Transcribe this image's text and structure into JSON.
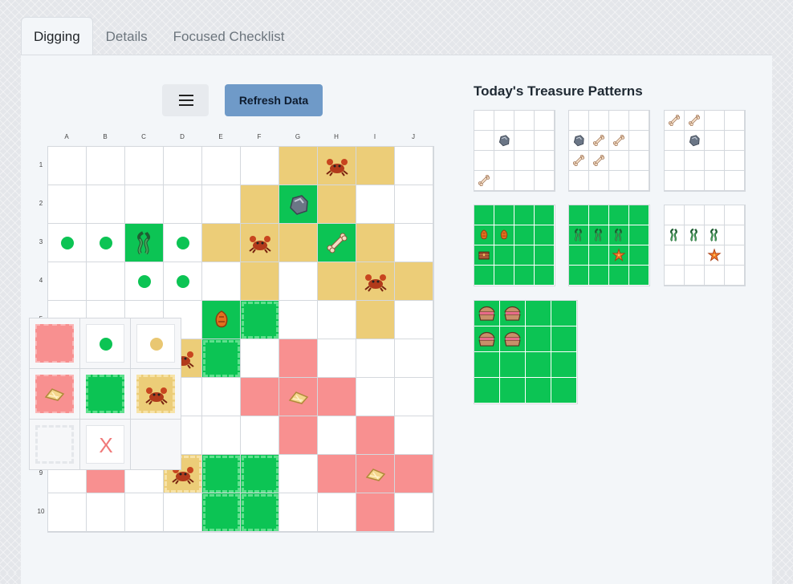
{
  "tabs": [
    {
      "label": "Digging",
      "active": true
    },
    {
      "label": "Details",
      "active": false
    },
    {
      "label": "Focused Checklist",
      "active": false
    }
  ],
  "toolbar": {
    "menu_icon": "hamburger-menu-icon",
    "refresh_label": "Refresh Data"
  },
  "board": {
    "columns": [
      "A",
      "B",
      "C",
      "D",
      "E",
      "F",
      "G",
      "H",
      "I",
      "J"
    ],
    "rows": [
      "1",
      "2",
      "3",
      "4",
      "5",
      "6",
      "7",
      "8",
      "9",
      "10"
    ],
    "cells": [
      {
        "r": 0,
        "c": 6,
        "s": "y"
      },
      {
        "r": 0,
        "c": 7,
        "s": "y",
        "item": "crab"
      },
      {
        "r": 0,
        "c": 8,
        "s": "y"
      },
      {
        "r": 1,
        "c": 5,
        "s": "y"
      },
      {
        "r": 1,
        "c": 6,
        "s": "g",
        "item": "stone"
      },
      {
        "r": 1,
        "c": 7,
        "s": "y"
      },
      {
        "r": 2,
        "c": 0,
        "s": "dot"
      },
      {
        "r": 2,
        "c": 1,
        "s": "dot"
      },
      {
        "r": 2,
        "c": 2,
        "s": "g",
        "item": "seaweed"
      },
      {
        "r": 2,
        "c": 3,
        "s": "dot"
      },
      {
        "r": 2,
        "c": 4,
        "s": "y"
      },
      {
        "r": 2,
        "c": 5,
        "s": "y",
        "item": "crab"
      },
      {
        "r": 2,
        "c": 6,
        "s": "y"
      },
      {
        "r": 2,
        "c": 7,
        "s": "g",
        "item": "bone"
      },
      {
        "r": 2,
        "c": 8,
        "s": "y"
      },
      {
        "r": 3,
        "c": 2,
        "s": "dot"
      },
      {
        "r": 3,
        "c": 3,
        "s": "dot"
      },
      {
        "r": 3,
        "c": 5,
        "s": "y"
      },
      {
        "r": 3,
        "c": 7,
        "s": "y"
      },
      {
        "r": 3,
        "c": 8,
        "s": "y",
        "item": "crab"
      },
      {
        "r": 3,
        "c": 9,
        "s": "y"
      },
      {
        "r": 4,
        "c": 4,
        "s": "g",
        "item": "amber"
      },
      {
        "r": 4,
        "c": 5,
        "s": "gd"
      },
      {
        "r": 4,
        "c": 8,
        "s": "y"
      },
      {
        "r": 5,
        "c": 3,
        "s": "y",
        "item": "crab"
      },
      {
        "r": 5,
        "c": 4,
        "s": "gd"
      },
      {
        "r": 5,
        "c": 6,
        "s": "r"
      },
      {
        "r": 6,
        "c": 5,
        "s": "r"
      },
      {
        "r": 6,
        "c": 6,
        "s": "r",
        "item": "shell"
      },
      {
        "r": 6,
        "c": 7,
        "s": "r"
      },
      {
        "r": 7,
        "c": 6,
        "s": "r"
      },
      {
        "r": 7,
        "c": 8,
        "s": "r"
      },
      {
        "r": 8,
        "c": 1,
        "s": "r"
      },
      {
        "r": 8,
        "c": 3,
        "s": "yd",
        "item": "crab"
      },
      {
        "r": 8,
        "c": 4,
        "s": "gd"
      },
      {
        "r": 8,
        "c": 5,
        "s": "gd"
      },
      {
        "r": 8,
        "c": 7,
        "s": "r"
      },
      {
        "r": 8,
        "c": 8,
        "s": "r",
        "item": "shell"
      },
      {
        "r": 8,
        "c": 9,
        "s": "r"
      },
      {
        "r": 9,
        "c": 4,
        "s": "gd"
      },
      {
        "r": 9,
        "c": 5,
        "s": "gd"
      },
      {
        "r": 9,
        "c": 8,
        "s": "r"
      }
    ]
  },
  "legend": {
    "items": [
      {
        "style": "pink",
        "icon": ""
      },
      {
        "style": "white",
        "dot": "#0cc454"
      },
      {
        "style": "white",
        "dot": "#e9c772"
      },
      {
        "style": "pink",
        "icon": "shell"
      },
      {
        "style": "green",
        "icon": ""
      },
      {
        "style": "yellow",
        "icon": "crab"
      },
      {
        "style": "empty",
        "icon": ""
      },
      {
        "style": "white",
        "text": "X"
      }
    ]
  },
  "patterns": {
    "title": "Today's Treasure Patterns",
    "grids": [
      {
        "size": "p4",
        "green": false,
        "cells": {
          "5": "stone",
          "12": "bone"
        }
      },
      {
        "size": "p4",
        "green": false,
        "cells": {
          "4": "stone",
          "5": "bone",
          "6": "bone",
          "8": "bone",
          "9": "bone"
        }
      },
      {
        "size": "p4",
        "green": false,
        "cells": {
          "0": "bone",
          "1": "bone",
          "5": "stone"
        }
      },
      {
        "size": "p4",
        "green": true,
        "cells": {
          "4": "amber",
          "5": "amber",
          "8": "chest"
        }
      },
      {
        "size": "p4",
        "green": true,
        "cells": {
          "4": "seaweed",
          "5": "seaweed",
          "6": "seaweed",
          "10": "starfish"
        }
      },
      {
        "size": "p4",
        "green": false,
        "cells": {
          "4": "seaweed",
          "5": "seaweed",
          "6": "seaweed",
          "10": "starfish"
        }
      },
      {
        "size": "p4b",
        "green": true,
        "cells": {
          "0": "clam",
          "1": "clam",
          "4": "clam",
          "5": "clam"
        }
      }
    ]
  },
  "colors": {
    "green": "#0cc454",
    "yellow": "#eccd78",
    "red": "#f89090",
    "accent": "#6f9ac8"
  }
}
